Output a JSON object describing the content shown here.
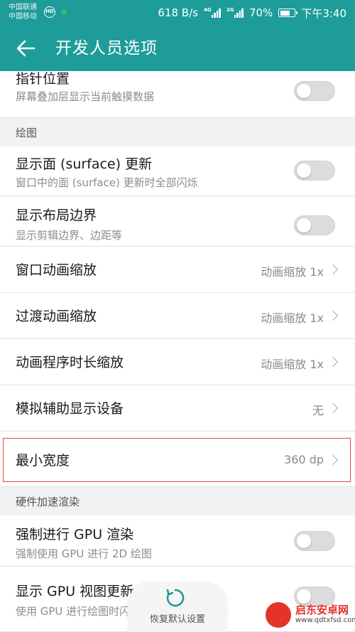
{
  "status_bar": {
    "carrier_1": "中国联通",
    "carrier_2": "中国移动",
    "hd_badge": "HD",
    "net_speed": "618 B/s",
    "sig1_tag": "4G",
    "sig2_tag": "2G",
    "battery": "70%",
    "time": "下午3:40"
  },
  "app_bar": {
    "title": "开发人员选项",
    "back_icon": "arrow-left-icon"
  },
  "rows": {
    "pointer": {
      "title": "指针位置",
      "subtitle": "屏幕叠加层显示当前触摸数据",
      "toggle": "off"
    },
    "drawing_header": "绘图",
    "surface": {
      "title": "显示面 (surface) 更新",
      "subtitle": "窗口中的面 (surface) 更新时全部闪烁",
      "toggle": "off"
    },
    "layout": {
      "title": "显示布局边界",
      "subtitle": "显示剪辑边界、边距等",
      "toggle": "off"
    },
    "window_anim": {
      "title": "窗口动画缩放",
      "value": "动画缩放 1x"
    },
    "transition_anim": {
      "title": "过渡动画缩放",
      "value": "动画缩放 1x"
    },
    "animator_duration": {
      "title": "动画程序时长缩放",
      "value": "动画缩放 1x"
    },
    "simulate_display": {
      "title": "模拟辅助显示设备",
      "value": "无"
    },
    "min_width": {
      "title": "最小宽度",
      "value": "360 dp"
    },
    "hw_header": "硬件加速渲染",
    "force_gpu": {
      "title": "强制进行 GPU 渲染",
      "subtitle": "强制使用 GPU 进行 2D 绘图",
      "toggle": "off"
    },
    "gpu_view": {
      "title": "显示 GPU 视图更新",
      "subtitle": "使用 GPU 进行绘图时闪烁显示窗口中的视图",
      "toggle": "off"
    }
  },
  "fab": {
    "label": "恢复默认设置",
    "icon": "refresh-icon"
  },
  "watermark": {
    "name": "启东安卓网",
    "url": "www.qdtxfsd.com"
  },
  "colors": {
    "accent": "#1d9c9a",
    "highlight": "#e14a4a",
    "toggle_off": "#dcdcdc"
  }
}
